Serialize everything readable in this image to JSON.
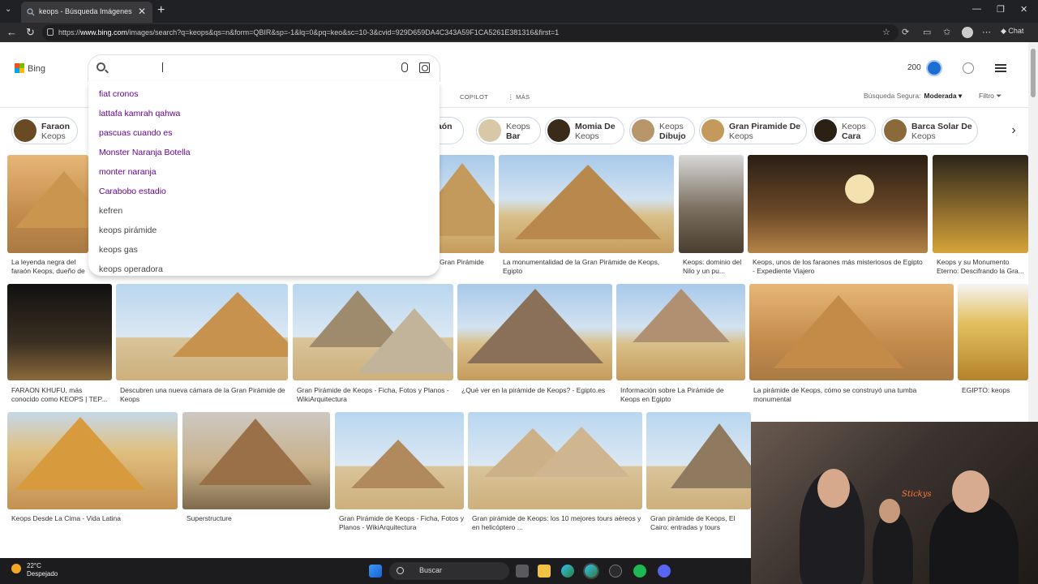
{
  "browser": {
    "tab_title": "keops - Búsqueda Imágenes",
    "tab_close": "✕",
    "new_tab": "+",
    "url_prefix": "https://",
    "url_host": "www.bing.com",
    "url_rest": "/images/search?q=keops&qs=n&form=QBIR&sp=-1&lq=0&pq=keo&sc=10-3&cvid=929D659DA4C343A59F1CA5261E381316&first=1",
    "chat_label": "Chat"
  },
  "bing": {
    "logo_text": "Bing",
    "search_value": "",
    "suggestions": [
      {
        "text": "fiat cronos",
        "color": "#660099"
      },
      {
        "text": "lattafa kamrah qahwa",
        "color": "#660099"
      },
      {
        "text": "pascuas cuando es",
        "color": "#660099"
      },
      {
        "text": "Monster Naranja Botella",
        "color": "#660099"
      },
      {
        "text": "monter naranja",
        "color": "#660099"
      },
      {
        "text": "Carabobo estadio",
        "color": "#660099"
      },
      {
        "text": "kefren",
        "color": "#444444"
      },
      {
        "text": "keops pirámide",
        "color": "#444444"
      },
      {
        "text": "keops gas",
        "color": "#444444"
      },
      {
        "text": "keops operadora",
        "color": "#444444"
      }
    ],
    "rewards_points": "200",
    "scopes": [
      "COPILOT",
      "⋮ MÁS"
    ],
    "safesearch_label": "Búsqueda Segura:",
    "safesearch_value": "Moderada ▾",
    "filter_label": "Filtro",
    "pills": [
      {
        "l1": "Faraon",
        "l2": "Keops",
        "bold": 1
      },
      {
        "l1": "araón",
        "l2": "ps",
        "bold": 1
      },
      {
        "l1": "Keops",
        "l2": "Bar",
        "bold": 2
      },
      {
        "l1": "Momia De",
        "l2": "Keops",
        "bold": 1
      },
      {
        "l1": "Keops",
        "l2": "Dibujo",
        "bold": 2
      },
      {
        "l1": "Gran Piramide De",
        "l2": "Keops",
        "bold": 1
      },
      {
        "l1": "Keops",
        "l2": "Cara",
        "bold": 2
      },
      {
        "l1": "Barca Solar De",
        "l2": "Keops",
        "bold": 1
      }
    ],
    "row1_captions": [
      "La leyenda negra del faraón Keops, dueño de la Gran Pirámide",
      "Gran Pirámide",
      "La monumentalidad de la Gran Pirámide de Keops, Egipto",
      "Keops: dominio del Nilo y un pu...",
      "Keops, unos de los faraones más misteriosos de Egipto - Expediente Viajero",
      "Keops y su Monumento Eterno: Descifrando la Gra..."
    ],
    "row2_captions": [
      "FARAON KHUFU, más conocido como KEOPS | TEP...",
      "Descubren una nueva cámara de la Gran Pirámide de Keops",
      "Gran Pirámide de Keops - Ficha, Fotos y Planos - WikiArquitectura",
      "¿Qué ver en la pirámide de Keops? - Egipto.es",
      "Información sobre La Pirámide de Keops en Egipto",
      "La pirámide de Keops, cómo se construyó una tumba monumental",
      "EGIPTO: keops"
    ],
    "row3_captions": [
      "Keops Desde La Cima - Vida Latina",
      "Superstructure",
      "Gran Pirámide de Keops - Ficha, Fotos y Planos - WikiArquitectura",
      "Gran pirámide de Keops: los 10 mejores tours aéreos y en helicóptero ...",
      "Gran pirámide de Keops, El Cairo: entradas y tours"
    ]
  },
  "webcam": {
    "neon_text": "Stickys"
  },
  "taskbar": {
    "temp": "22°C",
    "weather": "Despejado",
    "search_label": "Buscar"
  },
  "colors": {
    "accent": "#1b6fd0",
    "visited": "#660099"
  }
}
